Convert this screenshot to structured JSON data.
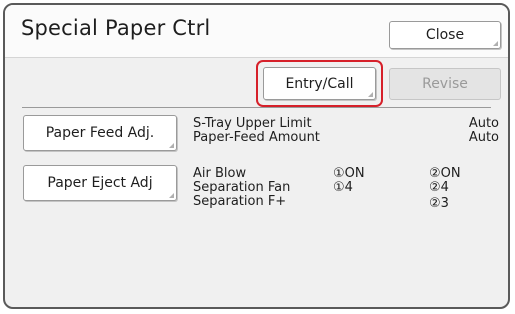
{
  "window": {
    "title": "Special Paper Ctrl",
    "close_label": "Close"
  },
  "toolbar": {
    "entry_call_label": "Entry/Call",
    "revise_label": "Revise"
  },
  "paper_feed": {
    "button_label": "Paper Feed Adj.",
    "settings": [
      {
        "label": "S-Tray Upper Limit",
        "value": "Auto"
      },
      {
        "label": "Paper-Feed Amount",
        "value": "Auto"
      }
    ]
  },
  "paper_eject": {
    "button_label": "Paper Eject Adj",
    "settings": [
      {
        "label": "Air Blow",
        "value1": "①ON",
        "value2": "②ON"
      },
      {
        "label": "Separation Fan",
        "value1": "①4",
        "value2": "②4"
      },
      {
        "label": "Separation F+",
        "value1": "",
        "value2": "②3"
      }
    ]
  },
  "colors": {
    "highlight": "#d6202a",
    "disabled_button": "#e4e4e4",
    "background": "#f0f0f0"
  }
}
